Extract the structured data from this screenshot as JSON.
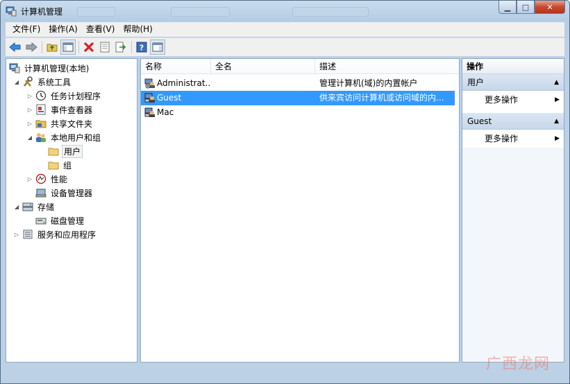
{
  "window": {
    "title": "计算机管理"
  },
  "menu": [
    {
      "label": "文件(F)"
    },
    {
      "label": "操作(A)"
    },
    {
      "label": "查看(V)"
    },
    {
      "label": "帮助(H)"
    }
  ],
  "toolbar": [
    "back-icon",
    "forward-icon",
    "up-folder-icon",
    "show-tree-icon",
    "delete-icon",
    "properties-icon",
    "export-icon",
    "help-icon",
    "show-action-pane-icon"
  ],
  "tree": [
    {
      "label": "计算机管理(本地)",
      "icon": "computer-management-icon"
    },
    {
      "label": "系统工具",
      "icon": "tools-icon"
    },
    {
      "label": "任务计划程序",
      "icon": "clock-icon"
    },
    {
      "label": "事件查看器",
      "icon": "event-viewer-icon"
    },
    {
      "label": "共享文件夹",
      "icon": "shared-folder-icon"
    },
    {
      "label": "本地用户和组",
      "icon": "users-group-icon"
    },
    {
      "label": "用户",
      "icon": "folder-icon"
    },
    {
      "label": "组",
      "icon": "folder-icon"
    },
    {
      "label": "性能",
      "icon": "performance-icon"
    },
    {
      "label": "设备管理器",
      "icon": "device-manager-icon"
    },
    {
      "label": "存储",
      "icon": "storage-icon"
    },
    {
      "label": "磁盘管理",
      "icon": "disk-icon"
    },
    {
      "label": "服务和应用程序",
      "icon": "services-icon"
    }
  ],
  "list": {
    "columns": [
      {
        "label": "名称"
      },
      {
        "label": "全名"
      },
      {
        "label": "描述"
      }
    ],
    "rows": [
      {
        "name": "Administrat...",
        "fullname": "",
        "desc": "管理计算机(域)的内置帐户"
      },
      {
        "name": "Guest",
        "fullname": "",
        "desc": "供来宾访问计算机或访问域的内..."
      },
      {
        "name": "Mac",
        "fullname": "",
        "desc": ""
      }
    ]
  },
  "actions": {
    "header": "操作",
    "sections": [
      {
        "title": "用户",
        "item": "更多操作"
      },
      {
        "title": "Guest",
        "item": "更多操作"
      }
    ]
  },
  "watermark": "广西龙网",
  "colors": {
    "selection": "#3399ff",
    "frame": "#bcd0e6"
  }
}
